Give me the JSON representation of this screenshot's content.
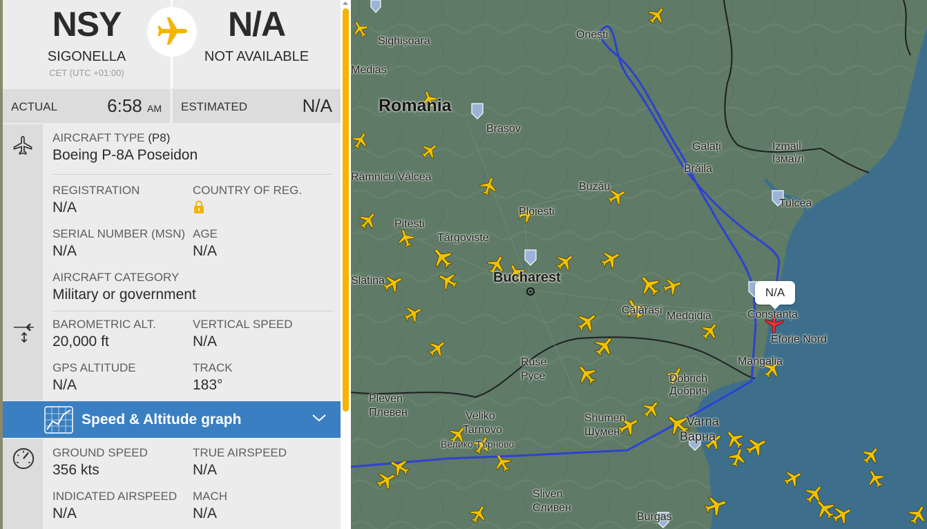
{
  "route": {
    "origin": {
      "code": "NSY",
      "city": "SIGONELLA",
      "timezone": "CET (UTC +01:00)"
    },
    "destination": {
      "code": "N/A",
      "city": "NOT AVAILABLE"
    },
    "plane_icon": "airplane-icon"
  },
  "times": {
    "actual_label": "ACTUAL",
    "actual_time": "6:58",
    "actual_ampm": "AM",
    "estimated_label": "ESTIMATED",
    "estimated_time": "N/A"
  },
  "aircraft": {
    "type_label": "AIRCRAFT TYPE",
    "type_code": "(P8)",
    "type_value": "Boeing P-8A Poseidon",
    "registration_label": "REGISTRATION",
    "registration_value": "N/A",
    "country_label": "COUNTRY OF REG.",
    "country_icon": "lock-icon",
    "msn_label": "SERIAL NUMBER (MSN)",
    "msn_value": "N/A",
    "age_label": "AGE",
    "age_value": "N/A",
    "category_label": "AIRCRAFT CATEGORY",
    "category_value": "Military or government"
  },
  "altitude": {
    "baro_label": "BAROMETRIC ALT.",
    "baro_value": "20,000 ft",
    "vs_label": "VERTICAL SPEED",
    "vs_value": "N/A",
    "gps_label": "GPS ALTITUDE",
    "gps_value": "N/A",
    "track_label": "TRACK",
    "track_value": "183°"
  },
  "graph": {
    "label": "Speed & Altitude graph"
  },
  "speed": {
    "ground_label": "GROUND SPEED",
    "ground_value": "356 kts",
    "tas_label": "TRUE AIRSPEED",
    "tas_value": "N/A",
    "ias_label": "INDICATED AIRSPEED",
    "ias_value": "N/A",
    "mach_label": "MACH",
    "mach_value": "N/A"
  },
  "map": {
    "callout": "N/A",
    "labels": {
      "romania": "Romania",
      "brasov": "Brașov",
      "sighisoara": "Sighișoara",
      "medias": "Mediaș",
      "onesti": "Onești",
      "galati": "Galați",
      "braila": "Brăila",
      "izmail": "Izmail",
      "izmail_uk": "Ізмаїл",
      "tulcea": "Tulcea",
      "buzau": "Buzău",
      "ploiesti": "Ploiești",
      "pitesti": "Pitești",
      "targoviste": "Târgoviște",
      "valcea": "Râmnicu Vâlcea",
      "bucharest": "Bucharest",
      "slatina": "Slatina",
      "calarasi": "Călărași",
      "medgidia": "Medgidia",
      "constanta": "Constanța",
      "eforie": "Eforie Nord",
      "mangalia": "Mangalia",
      "dobrich": "Dobrich",
      "dobrich_bg": "Добрич",
      "ruse": "Ruse",
      "ruse_bg": "Русе",
      "pleven": "Pleven",
      "pleven_bg": "Плевен",
      "veliko": "Veliko",
      "tarnovo": "Tarnovo",
      "tarnovo_bg": "Велико Търново",
      "shumen": "Shumen",
      "shumen_bg": "Шумен",
      "varna": "Varna",
      "varna_bg": "Варна",
      "sliven": "Sliven",
      "sliven_bg": "Сливен",
      "burgas": "Burgas"
    },
    "colors": {
      "land": "#5f7a66",
      "sea": "#3d6f8c",
      "track": "#2a3fd6",
      "traffic": "#f2c200",
      "target": "#e8343c"
    }
  }
}
